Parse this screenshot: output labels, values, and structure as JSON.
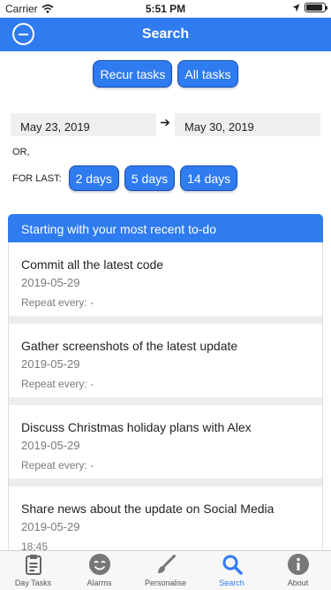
{
  "status": {
    "carrier": "Carrier",
    "time": "5:51 PM",
    "battery_fraction": 0.9
  },
  "header": {
    "title": "Search"
  },
  "filters": {
    "recur_label": "Recur tasks",
    "all_label": "All tasks"
  },
  "date_range": {
    "start": "May 23, 2019",
    "end": "May 30, 2019",
    "arrow": "➔"
  },
  "or_label": "OR,",
  "for_last": {
    "label": "FOR LAST:",
    "options": [
      "2 days",
      "5 days",
      "14 days"
    ]
  },
  "section": {
    "title": "Starting with your most recent to-do"
  },
  "tasks": [
    {
      "title": "Commit all the latest code",
      "date": "2019-05-29",
      "repeat": "Repeat every: -"
    },
    {
      "title": "Gather screenshots of the latest update",
      "date": "2019-05-29",
      "repeat": "Repeat every: -"
    },
    {
      "title": "Discuss Christmas holiday plans with Alex",
      "date": "2019-05-29",
      "repeat": "Repeat every: -"
    },
    {
      "title": "Share news about the update on Social Media",
      "date": "2019-05-29",
      "repeat": "18:45"
    }
  ],
  "tabs": [
    {
      "label": "Day Tasks",
      "icon": "clipboard-icon"
    },
    {
      "label": "Alarms",
      "icon": "smiley-icon"
    },
    {
      "label": "Personalise",
      "icon": "brush-icon"
    },
    {
      "label": "Search",
      "icon": "search-icon"
    },
    {
      "label": "About",
      "icon": "info-icon"
    }
  ],
  "colors": {
    "accent": "#2f7bf0",
    "tab_inactive": "#555555"
  }
}
